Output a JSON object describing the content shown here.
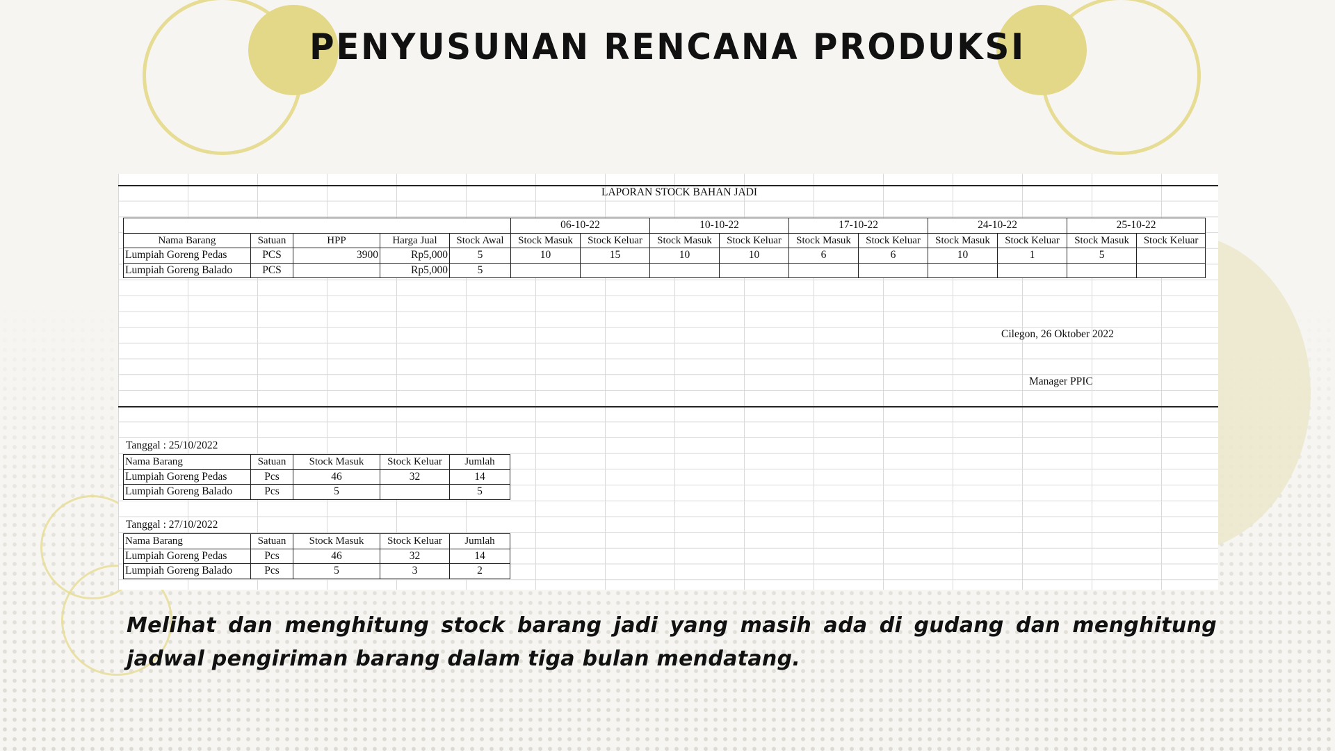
{
  "page": {
    "title": "PENYUSUNAN RENCANA PRODUKSI",
    "caption": "Melihat dan menghitung stock barang jadi yang masih ada di gudang dan menghitung jadwal pengiriman barang dalam tiga bulan mendatang."
  },
  "colors": {
    "accent": "#e3d788",
    "ring": "#e6dc94",
    "background": "#f6f5f1"
  },
  "report": {
    "title": "LAPORAN STOCK BAHAN JADI",
    "dates": [
      "06-10-22",
      "10-10-22",
      "17-10-22",
      "24-10-22",
      "25-10-22"
    ],
    "columns": {
      "nama_barang": "Nama Barang",
      "satuan": "Satuan",
      "hpp": "HPP",
      "harga_jual": "Harga Jual",
      "stock_awal": "Stock Awal",
      "stock_masuk": "Stock Masuk",
      "stock_keluar": "Stock Keluar"
    },
    "rows": [
      {
        "nama": "Lumpiah Goreng Pedas",
        "satuan": "PCS",
        "hpp": "3900",
        "harga_jual": "Rp5,000",
        "stock_awal": "5",
        "movements": [
          [
            "10",
            "15"
          ],
          [
            "10",
            "10"
          ],
          [
            "6",
            "6"
          ],
          [
            "10",
            "1"
          ],
          [
            "5",
            ""
          ]
        ]
      },
      {
        "nama": "Lumpiah Goreng Balado",
        "satuan": "PCS",
        "hpp": "",
        "harga_jual": "Rp5,000",
        "stock_awal": "5",
        "movements": [
          [
            "",
            ""
          ],
          [
            "",
            ""
          ],
          [
            "",
            ""
          ],
          [
            "",
            ""
          ],
          [
            "",
            ""
          ]
        ]
      }
    ],
    "place_date": "Cilegon, 26 Oktober 2022",
    "signatory": "Manager PPIC"
  },
  "daily": [
    {
      "label": "Tanggal : 25/10/2022",
      "headers": [
        "Nama Barang",
        "Satuan",
        "Stock Masuk",
        "Stock Keluar",
        "Jumlah"
      ],
      "rows": [
        [
          "Lumpiah Goreng Pedas",
          "Pcs",
          "46",
          "32",
          "14"
        ],
        [
          "Lumpiah Goreng Balado",
          "Pcs",
          "5",
          "",
          "5"
        ]
      ]
    },
    {
      "label": "Tanggal : 27/10/2022",
      "headers": [
        "Nama Barang",
        "Satuan",
        "Stock Masuk",
        "Stock Keluar",
        "Jumlah"
      ],
      "rows": [
        [
          "Lumpiah Goreng Pedas",
          "Pcs",
          "46",
          "32",
          "14"
        ],
        [
          "Lumpiah Goreng Balado",
          "Pcs",
          "5",
          "3",
          "2"
        ]
      ]
    }
  ]
}
